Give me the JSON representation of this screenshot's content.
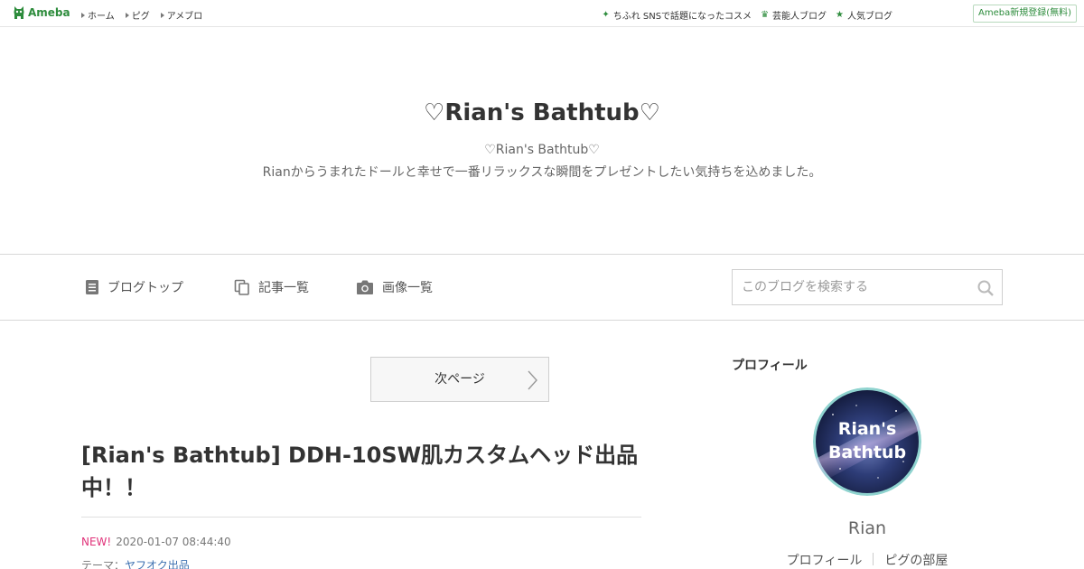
{
  "topbar": {
    "logo_text": "Ameba",
    "nav": [
      "ホーム",
      "ピグ",
      "アメブロ"
    ],
    "links": [
      {
        "icon": "sparkle-icon",
        "label": "ちふれ SNSで話題になったコスメ"
      },
      {
        "icon": "crown-icon",
        "label": "芸能人ブログ"
      },
      {
        "icon": "star-icon",
        "label": "人気ブログ"
      }
    ],
    "signup_label": "Ameba新規登録(無料)"
  },
  "header": {
    "title": "♡Rian's Bathtub♡",
    "subtitle": "♡Rian's Bathtub♡",
    "description": "Rianからうまれたドールと幸せで一番リラックスな瞬間をプレゼントしたい気持ちを込めました。"
  },
  "nav": {
    "items": [
      {
        "icon": "document-icon",
        "label": "ブログトップ"
      },
      {
        "icon": "copy-icon",
        "label": "記事一覧"
      },
      {
        "icon": "camera-icon",
        "label": "画像一覧"
      }
    ],
    "search_placeholder": "このブログを検索する"
  },
  "main": {
    "next_page_label": "次ページ",
    "post": {
      "title": "[Rian's Bathtub] DDH-10SW肌カスタムヘッド出品中！！",
      "new_badge": "NEW!",
      "date": "2020-01-07 08:44:40",
      "theme_label": "テーマ：",
      "theme_value": "ヤフオク出品"
    }
  },
  "sidebar": {
    "heading": "プロフィール",
    "avatar_text_line1": "Rian's",
    "avatar_text_line2": "Bathtub",
    "name": "Rian",
    "links": [
      "プロフィール",
      "ピグの部屋"
    ]
  },
  "colors": {
    "brand_green": "#2d8c3c",
    "new_badge": "#e0337a",
    "link_blue": "#3b6fb0"
  }
}
